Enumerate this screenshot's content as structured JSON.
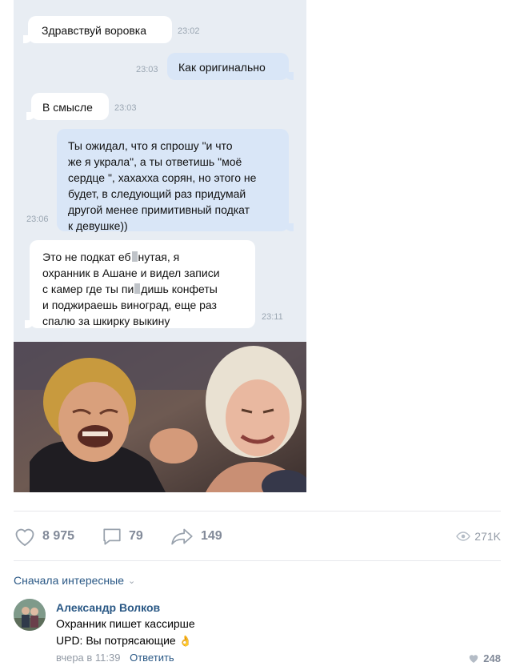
{
  "chat": {
    "messages": [
      {
        "direction": "in",
        "text": "Здравствуй воровка",
        "time": "23:02"
      },
      {
        "direction": "out",
        "text": "Как оригинально",
        "time": "23:03"
      },
      {
        "direction": "in",
        "text": "В смысле",
        "time": "23:03"
      },
      {
        "direction": "out",
        "lines": [
          "Ты ожидал, что я спрошу \"и что",
          "же я украла\", а ты ответишь \"моё",
          "сердце \", хахахха сорян, но этого не",
          "будет, в следующий раз придумай",
          "другой менее примитивный подкат",
          "к девушке))"
        ],
        "time": "23:06"
      },
      {
        "direction": "in",
        "lines": [
          [
            "Это не подкат еб",
            "нутая,  я"
          ],
          [
            "охранник в Ашане и видел записи"
          ],
          [
            "с камер где ты пи",
            "дишь конфеты"
          ],
          [
            "и поджираешь виноград, еще раз"
          ],
          [
            "спалю за шкирку выкину"
          ]
        ],
        "time": "23:11"
      }
    ]
  },
  "post_stats": {
    "likes": "8 975",
    "comments": "79",
    "shares": "149",
    "views": "271K"
  },
  "comments_section": {
    "sort_label": "Сначала интересные",
    "comment": {
      "author": "Александр Волков",
      "line1": "Охранник пишет кассирше",
      "line2": "UPD: Вы потрясающие",
      "emoji": "👌",
      "time": "вчера в 11:39",
      "reply_label": "Ответить",
      "likes": "248"
    }
  },
  "colors": {
    "link": "#2a5885",
    "muted": "#828a99",
    "chat_bg": "#e8edf3",
    "out_bubble": "#d9e6f7"
  }
}
